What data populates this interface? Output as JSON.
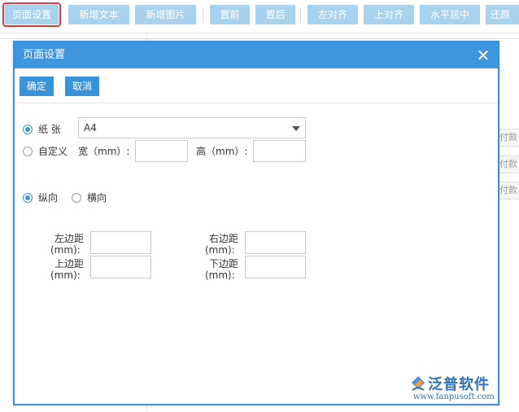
{
  "toolbar": {
    "buttons": [
      {
        "label": "页面设置",
        "active": true
      },
      {
        "label": "新增文本"
      },
      {
        "label": "新增图片"
      },
      {
        "label": "置前"
      },
      {
        "label": "置后"
      },
      {
        "label": "左对齐"
      },
      {
        "label": "上对齐"
      },
      {
        "label": "水平居中"
      },
      {
        "label": "还原"
      }
    ]
  },
  "background": {
    "side_tags": [
      "付款",
      "付款",
      "付款"
    ]
  },
  "dialog": {
    "title": "页面设置",
    "close_icon": "close-icon",
    "confirm_label": "确定",
    "cancel_label": "取消",
    "paper_label": "纸 张",
    "paper_value": "A4",
    "custom_label": "自定义",
    "width_label": "宽（mm）:",
    "height_label": "高（mm）:",
    "width_value": "",
    "height_value": "",
    "portrait_label": "纵向",
    "landscape_label": "横向",
    "left_margin_label": "左边距",
    "right_margin_label": "右边距",
    "top_margin_label": "上边距",
    "bottom_margin_label": "下边距",
    "mm_label": "(mm):",
    "left_margin_value": "",
    "right_margin_value": "",
    "top_margin_value": "",
    "bottom_margin_value": ""
  },
  "watermark": {
    "brand": "泛普软件",
    "url": "www.fanpusoft.com"
  },
  "colors": {
    "accent": "#3f95de",
    "toolbar_button": "#a9d2ee",
    "highlight": "#e03a3a"
  }
}
